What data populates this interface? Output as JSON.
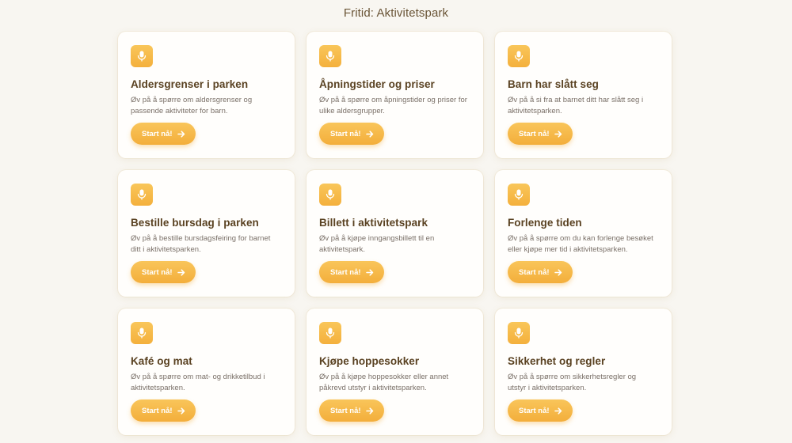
{
  "page": {
    "title": "Fritid: Aktivitetspark"
  },
  "theme": {
    "accent": "#f4b03c",
    "background": "#f8f6f1",
    "card": "#fffefc",
    "title_text": "#5a4222",
    "body_text": "#7a7068"
  },
  "cards": [
    {
      "icon": "microphone-icon",
      "title": "Aldersgrenser i parken",
      "description": "Øv på å spørre om aldersgrenser og passende aktiviteter for barn.",
      "button_label": "Start nå!"
    },
    {
      "icon": "microphone-icon",
      "title": "Åpningstider og priser",
      "description": "Øv på å spørre om åpningstider og priser for ulike aldersgrupper.",
      "button_label": "Start nå!"
    },
    {
      "icon": "microphone-icon",
      "title": "Barn har slått seg",
      "description": "Øv på å si fra at barnet ditt har slått seg i aktivitetsparken.",
      "button_label": "Start nå!"
    },
    {
      "icon": "microphone-icon",
      "title": "Bestille bursdag i parken",
      "description": "Øv på å bestille bursdagsfeiring for barnet ditt i aktivitetsparken.",
      "button_label": "Start nå!"
    },
    {
      "icon": "microphone-icon",
      "title": "Billett i aktivitetspark",
      "description": "Øv på å kjøpe inngangsbillett til en aktivitetspark.",
      "button_label": "Start nå!"
    },
    {
      "icon": "microphone-icon",
      "title": "Forlenge tiden",
      "description": "Øv på å spørre om du kan forlenge besøket eller kjøpe mer tid i aktivitetsparken.",
      "button_label": "Start nå!"
    },
    {
      "icon": "microphone-icon",
      "title": "Kafé og mat",
      "description": "Øv på å spørre om mat- og drikketilbud i aktivitetsparken.",
      "button_label": "Start nå!"
    },
    {
      "icon": "microphone-icon",
      "title": "Kjøpe hoppesokker",
      "description": "Øv på å kjøpe hoppesokker eller annet påkrevd utstyr i aktivitetsparken.",
      "button_label": "Start nå!"
    },
    {
      "icon": "microphone-icon",
      "title": "Sikkerhet og regler",
      "description": "Øv på å spørre om sikkerhetsregler og utstyr i aktivitetsparken.",
      "button_label": "Start nå!"
    }
  ]
}
